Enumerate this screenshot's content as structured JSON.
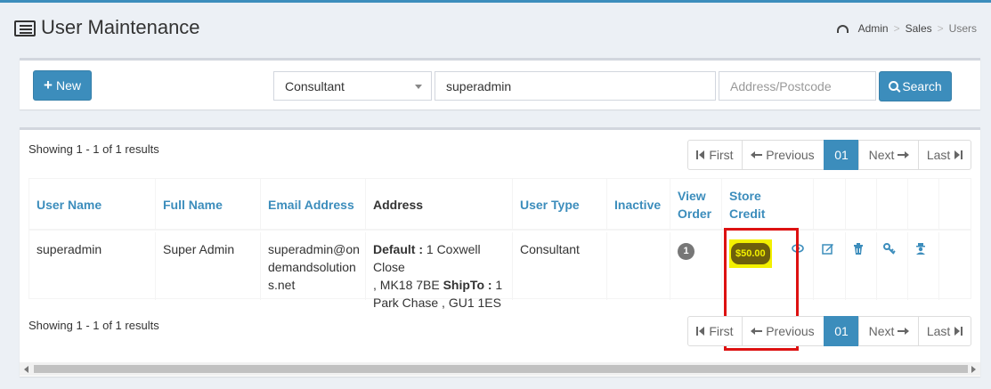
{
  "page": {
    "title": "User Maintenance",
    "breadcrumb": [
      "Admin",
      "Sales",
      "Users"
    ]
  },
  "toolbar": {
    "new_label": "New",
    "user_type_selected": "Consultant",
    "search_value": "superadmin",
    "address_placeholder": "Address/Postcode",
    "search_label": "Search"
  },
  "results": {
    "showing_top": "Showing 1 - 1 of 1 results",
    "showing_bottom": "Showing 1 - 1 of 1 results"
  },
  "pagination": {
    "first": "First",
    "previous": "Previous",
    "current": "01",
    "next": "Next",
    "last": "Last"
  },
  "table": {
    "headers": {
      "user_name": "User Name",
      "full_name": "Full Name",
      "email": "Email Address",
      "address": "Address",
      "user_type": "User Type",
      "inactive": "Inactive",
      "view_order_1": "View",
      "view_order_2": "Order",
      "store_credit_1": "Store",
      "store_credit_2": "Credit"
    },
    "rows": [
      {
        "user_name": "superadmin",
        "full_name": "Super Admin",
        "email_1": "superadmin@on",
        "email_2": "demandsolution",
        "email_3": "s.net",
        "default_label": "Default :",
        "default_text": " 1 Coxwell Close",
        "default_text_2": ", MK18 7BE ",
        "shipto_label": "ShipTo :",
        "shipto_text": " 1",
        "shipto_text_2": "Park Chase , GU1 1ES",
        "user_type": "Consultant",
        "inactive": "",
        "view_order_count": "1",
        "store_credit": "$50.00"
      }
    ]
  },
  "colors": {
    "primary": "#3c8dbc",
    "highlight": "#f3f000",
    "annotation": "#dd1111"
  }
}
